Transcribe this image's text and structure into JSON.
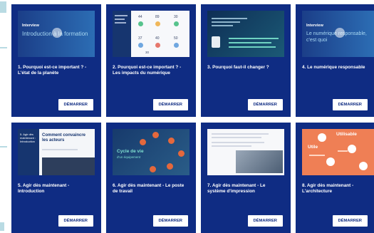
{
  "cards": [
    {
      "title": "1. Pourquoi est-ce important ? - L'état de la planète",
      "button": "DÉMARRER",
      "thumb": {
        "label_small": "Interview",
        "label_big": "Introduction à la formation"
      }
    },
    {
      "title": "2. Pourquoi est-ce important ? - Les impacts du numérique",
      "button": "DÉMARRER",
      "thumb": {
        "stats": [
          "44",
          "89",
          "30",
          "37",
          "40",
          "50",
          "30"
        ]
      }
    },
    {
      "title": "3. Pourquoi faut-il changer ?",
      "button": "DÉMARRER",
      "thumb": {}
    },
    {
      "title": "4. Le numérique responsable",
      "button": "DÉMARRER",
      "thumb": {
        "label_small": "Interview",
        "label_big": "Le numérique responsable, c'est quoi"
      }
    },
    {
      "title": "5. Agir dès maintenant - Introduction",
      "button": "DÉMARRER",
      "thumb": {
        "side_title": "5. Agir dès maintenant : Introduction",
        "main_title": "Comment convaincre les acteurs"
      }
    },
    {
      "title": "6. Agir dès maintenant - Le poste de travail",
      "button": "DÉMARRER",
      "thumb": {
        "label_big": "Cycle de vie",
        "label_small": "d'un équipement"
      }
    },
    {
      "title": "7. Agir dès maintenant - Le système d'impression",
      "button": "DÉMARRER",
      "thumb": {}
    },
    {
      "title": "8. Agir dès maintenant - L'architecture",
      "button": "DÉMARRER",
      "thumb": {
        "word1": "Utilisable",
        "word2": "Utile"
      }
    }
  ]
}
